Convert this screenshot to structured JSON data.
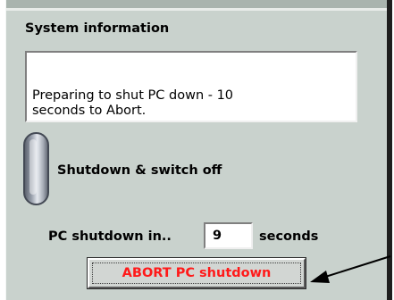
{
  "panel": {
    "title": "System information",
    "info_text": "Preparing to shut PC down - 10\nseconds to Abort."
  },
  "toggle": {
    "label": "Shutdown & switch off",
    "state": "on"
  },
  "countdown": {
    "label": "PC shutdown in..",
    "value": "9",
    "unit": "seconds"
  },
  "abort": {
    "label": "ABORT PC shutdown",
    "label_color": "#ff1a1a"
  },
  "annotation": {
    "icon": "arrow-pointer-icon"
  },
  "colors": {
    "panel_bg": "#c9d2cd",
    "button_text": "#ff1a1a"
  }
}
